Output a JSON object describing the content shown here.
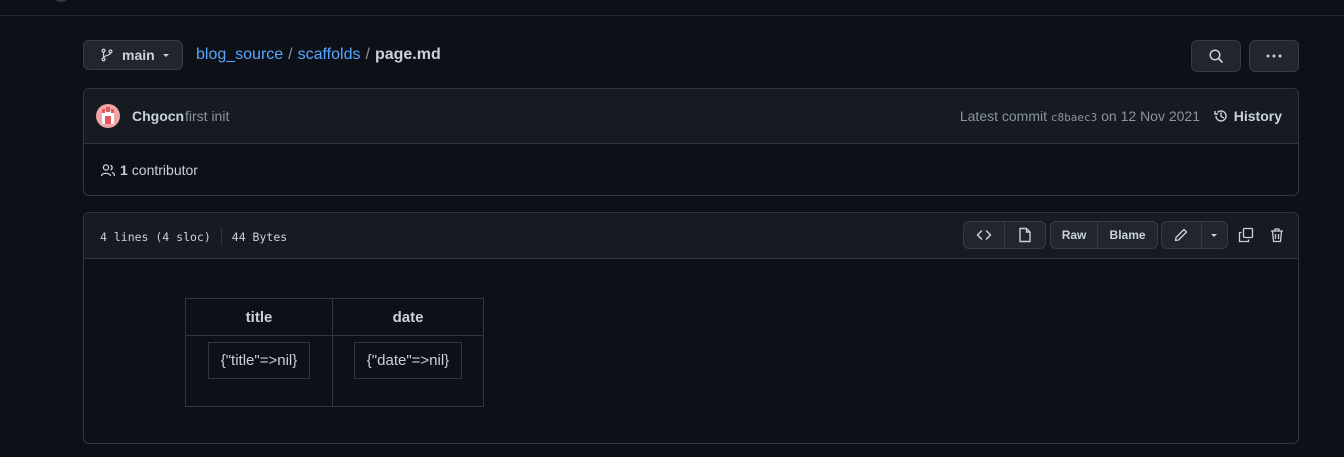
{
  "repo": {
    "branch": "main",
    "path": [
      "blog_source",
      "scaffolds"
    ],
    "file": "page.md",
    "separator": "/"
  },
  "commit": {
    "author": "Chgocn",
    "message": "first init",
    "latest_label": "Latest commit",
    "sha": "c8baec3",
    "date_text": "on 12 Nov 2021",
    "history_label": "History"
  },
  "contributors": {
    "count": "1",
    "label": "contributor"
  },
  "file_info": {
    "lines": "4 lines (4 sloc)",
    "size": "44 Bytes"
  },
  "toolbar": {
    "raw_label": "Raw",
    "blame_label": "Blame"
  },
  "front_matter": {
    "headers": [
      "title",
      "date"
    ],
    "values": [
      "{\"title\"=>nil}",
      "{\"date\"=>nil}"
    ]
  },
  "colors": {
    "background": "#0d1117",
    "link": "#58a6ff",
    "muted": "#8b949e",
    "border": "#30363d"
  },
  "icons": {
    "branch": "git-branch-icon",
    "search": "search-icon",
    "more": "kebab-horizontal-icon",
    "history": "history-icon",
    "people": "people-icon",
    "code": "code-icon",
    "file": "file-icon",
    "pencil": "pencil-icon",
    "copy": "copy-icon",
    "trash": "trash-icon"
  }
}
